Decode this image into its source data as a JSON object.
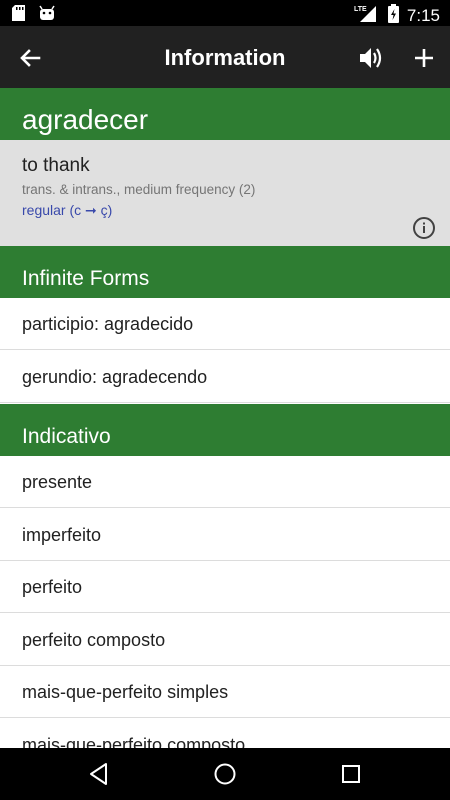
{
  "status_bar": {
    "time": "7:15",
    "network": "LTE",
    "icons": [
      "sd-card-icon",
      "android-icon",
      "signal-icon",
      "battery-charging-icon"
    ]
  },
  "app_bar": {
    "title": "Information",
    "back_icon": "arrow-back-icon",
    "speaker_icon": "volume-icon",
    "add_icon": "plus-icon"
  },
  "word": {
    "infinitive": "agradecer",
    "translation": "to thank",
    "meta": "trans. & intrans., medium frequency (2)",
    "regularity": "regular (c ➞ ç)"
  },
  "sections": [
    {
      "title": "Infinite Forms",
      "items": [
        "participio: agradecido",
        "gerundio: agradecendo"
      ]
    },
    {
      "title": "Indicativo",
      "items": [
        "presente",
        "imperfeito",
        "perfeito",
        "perfeito composto",
        "mais-que-perfeito simples",
        "mais-que-perfeito composto"
      ]
    }
  ],
  "colors": {
    "primary_green": "#2e7d32",
    "app_bar": "#212121",
    "card_bg": "#e0e0e0",
    "link_blue": "#3949ab"
  }
}
